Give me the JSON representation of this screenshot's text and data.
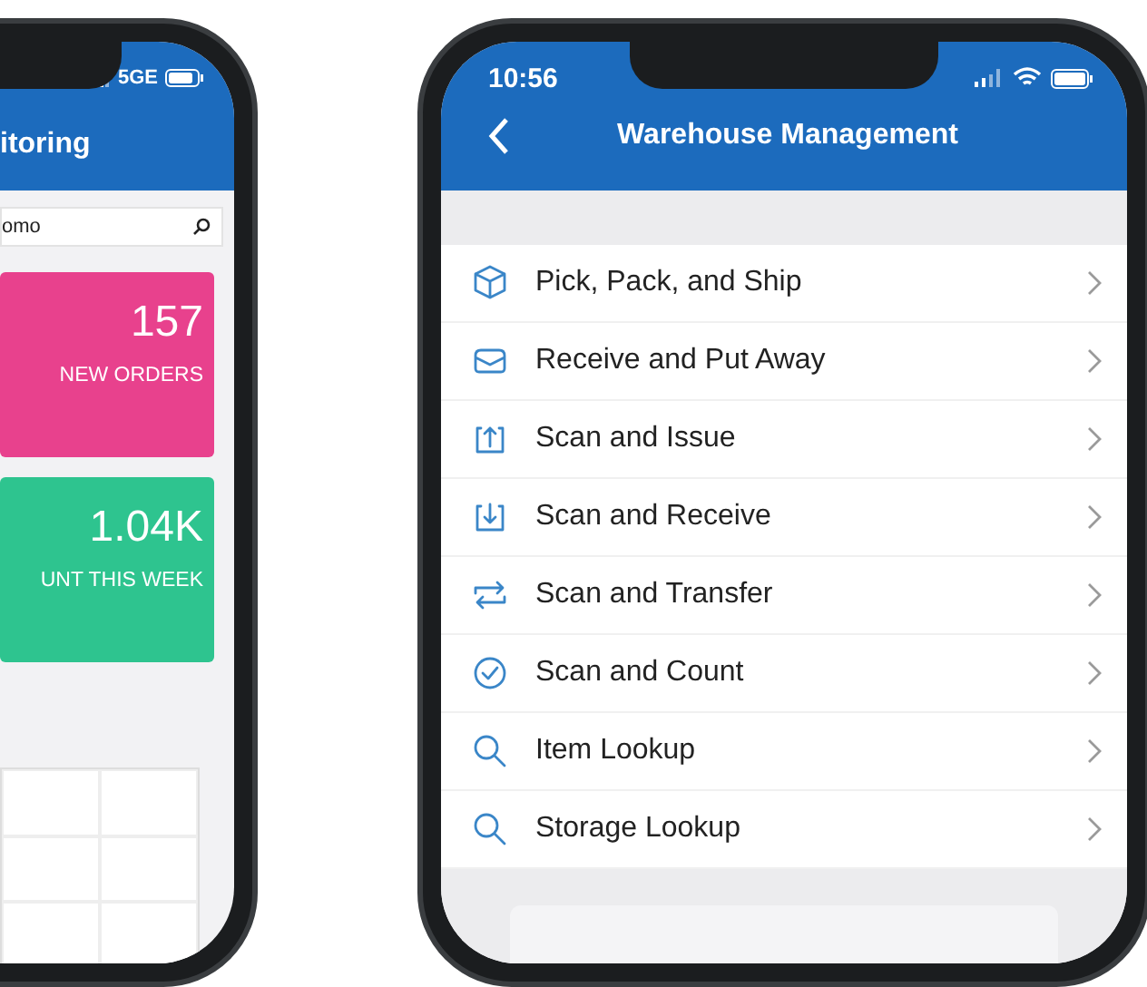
{
  "left_phone": {
    "status_bar": {
      "network": "5GE"
    },
    "header": {
      "title": "itoring"
    },
    "search": {
      "value": "omo"
    },
    "cards": [
      {
        "value": "157",
        "label": "NEW ORDERS",
        "color": "#e8418d"
      },
      {
        "value": "1.04K",
        "label": "UNT THIS WEEK",
        "color": "#2ec48f"
      }
    ]
  },
  "right_phone": {
    "status_bar": {
      "time": "10:56"
    },
    "header": {
      "title": "Warehouse Management"
    },
    "menu": [
      {
        "label": "Pick, Pack, and Ship",
        "kind": "box"
      },
      {
        "label": "Receive and Put Away",
        "kind": "tray"
      },
      {
        "label": "Scan and Issue",
        "kind": "issue"
      },
      {
        "label": "Scan and Receive",
        "kind": "receive"
      },
      {
        "label": "Scan and Transfer",
        "kind": "transfer"
      },
      {
        "label": "Scan and Count",
        "kind": "count"
      },
      {
        "label": "Item Lookup",
        "kind": "search"
      },
      {
        "label": "Storage Lookup",
        "kind": "search"
      }
    ]
  }
}
